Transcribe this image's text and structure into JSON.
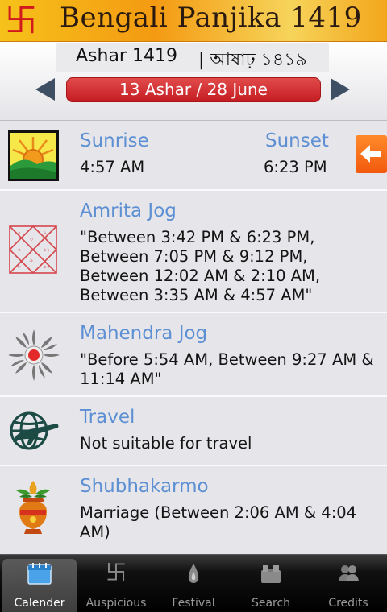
{
  "banner": {
    "title": "Bengali Panjika 1419",
    "icon": "swastika-icon"
  },
  "header": {
    "month_en": "Ashar 1419",
    "month_bn": "| আষাঢ় ১৪১৯",
    "date": "13 Ashar / 28 June",
    "prev": "previous-arrow-icon",
    "next": "next-arrow-icon"
  },
  "rows": {
    "sun": {
      "sunrise_label": "Sunrise",
      "sunrise_time": "4:57 AM",
      "sunset_label": "Sunset",
      "sunset_time": "6:23 PM",
      "icon": "sunrise-icon",
      "back_icon": "back-arrow-icon"
    },
    "amrita": {
      "label": "Amrita Jog",
      "value": "\"Between 3:42 PM & 6:23 PM, Between 7:05 PM & 9:12 PM, Between 12:02 AM & 2:10 AM, Between 3:35 AM & 4:57 AM\"",
      "icon": "horoscope-chart-icon"
    },
    "mahendra": {
      "label": "Mahendra Jog",
      "value": "\"Before 5:54 AM, Between 9:27 AM & 11:14 AM\"",
      "icon": "sun-rays-icon"
    },
    "travel": {
      "label": "Travel",
      "value": "Not suitable for travel",
      "icon": "globe-plane-icon"
    },
    "shubha": {
      "label": "Shubhakarmo",
      "value": "Marriage (Between 2:06 AM & 4:04 AM)",
      "icon": "kalash-icon"
    }
  },
  "tabs": [
    {
      "label": "Calender",
      "icon": "calendar-icon",
      "active": true
    },
    {
      "label": "Auspicious",
      "icon": "swastika-icon",
      "active": false
    },
    {
      "label": "Festival",
      "icon": "lamp-icon",
      "active": false
    },
    {
      "label": "Search",
      "icon": "search-icon",
      "active": false
    },
    {
      "label": "Credits",
      "icon": "people-icon",
      "active": false
    }
  ],
  "colors": {
    "accent": "#5d8fd3",
    "date_pill": "#d22a2e",
    "banner": "#f4a51a"
  }
}
